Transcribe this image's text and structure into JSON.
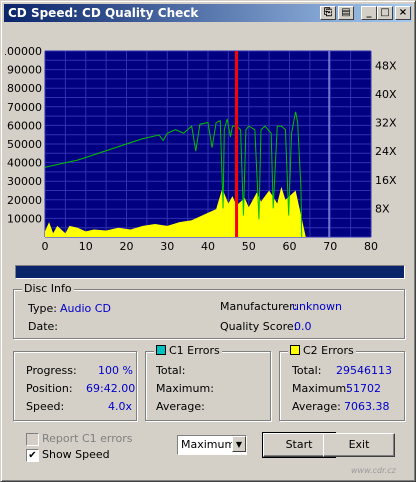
{
  "window": {
    "title": "CD Speed: CD Quality Check",
    "buttons": [
      "?",
      "?",
      "_",
      "□",
      "×"
    ]
  },
  "chart_data": {
    "type": "line",
    "y_left": {
      "range": [
        0,
        100000
      ],
      "ticks": [
        "10000",
        "20000",
        "30000",
        "40000",
        "50000",
        "60000",
        "70000",
        "80000",
        "90000",
        "100000"
      ]
    },
    "y_right": {
      "range": [
        0,
        52
      ],
      "ticks": [
        "8X",
        "16X",
        "24X",
        "32X",
        "40X",
        "48X"
      ]
    },
    "x": {
      "range": [
        0,
        80
      ],
      "ticks": [
        "0",
        "10",
        "20",
        "30",
        "40",
        "50",
        "60",
        "70",
        "80"
      ]
    },
    "colors": {
      "bg": "#000080",
      "grid": "#3030b0",
      "speed": "#00c000",
      "errors": "#ffff00",
      "position": "#ff0000",
      "end": "#c0c0ff"
    },
    "position_marker": 47,
    "end_marker": 69.7,
    "speed_series": [
      [
        0,
        19.5
      ],
      [
        4,
        20.5
      ],
      [
        8,
        21.5
      ],
      [
        12,
        23
      ],
      [
        16,
        24.5
      ],
      [
        20,
        26
      ],
      [
        24,
        27.5
      ],
      [
        28,
        28.5
      ],
      [
        29,
        27
      ],
      [
        30,
        29
      ],
      [
        32,
        30
      ],
      [
        34,
        29
      ],
      [
        36,
        31
      ],
      [
        37,
        24
      ],
      [
        38,
        31.5
      ],
      [
        40,
        32
      ],
      [
        41,
        25
      ],
      [
        42,
        32
      ],
      [
        43,
        32.5
      ],
      [
        43.7,
        8
      ],
      [
        44,
        30
      ],
      [
        44.7,
        33
      ],
      [
        45.5,
        28
      ],
      [
        46,
        31
      ],
      [
        47,
        31
      ],
      [
        48,
        30
      ],
      [
        48.7,
        6
      ],
      [
        49.3,
        30
      ],
      [
        50,
        31
      ],
      [
        51.5,
        30
      ],
      [
        52.5,
        5
      ],
      [
        53,
        30
      ],
      [
        54,
        31
      ],
      [
        55.5,
        29
      ],
      [
        56,
        8
      ],
      [
        57,
        31
      ],
      [
        58,
        31
      ],
      [
        59,
        30
      ],
      [
        59.8,
        6
      ],
      [
        60.5,
        29
      ],
      [
        61.5,
        35
      ],
      [
        62,
        32
      ],
      [
        62.8,
        14
      ],
      [
        63,
        0
      ]
    ],
    "error_series": [
      [
        0,
        3000
      ],
      [
        1,
        8000
      ],
      [
        2,
        2000
      ],
      [
        3,
        6000
      ],
      [
        5,
        2000
      ],
      [
        6,
        6000
      ],
      [
        8,
        5000
      ],
      [
        10,
        3000
      ],
      [
        12,
        4000
      ],
      [
        15,
        3500
      ],
      [
        18,
        5000
      ],
      [
        21,
        4000
      ],
      [
        24,
        6000
      ],
      [
        27,
        7000
      ],
      [
        30,
        6000
      ],
      [
        33,
        8000
      ],
      [
        36,
        9000
      ],
      [
        39,
        12000
      ],
      [
        42,
        15000
      ],
      [
        43.5,
        26000
      ],
      [
        45,
        18000
      ],
      [
        46,
        22000
      ],
      [
        47,
        17000
      ],
      [
        49,
        21000
      ],
      [
        50,
        16000
      ],
      [
        52,
        24000
      ],
      [
        53,
        19000
      ],
      [
        55,
        25000
      ],
      [
        57,
        18000
      ],
      [
        58,
        27000
      ],
      [
        59,
        20000
      ],
      [
        60,
        22000
      ],
      [
        61.5,
        25000
      ],
      [
        63,
        10000
      ],
      [
        64,
        0
      ]
    ]
  },
  "disc_info": {
    "title": "Disc Info",
    "type_label": "Type:",
    "type_value": "Audio CD",
    "date_label": "Date:",
    "manufacturer_label": "Manufacturer:",
    "manufacturer_value": "unknown",
    "quality_label": "Quality Score:",
    "quality_value": "0.0"
  },
  "status": {
    "progress_label": "Progress:",
    "progress_value": "100 %",
    "position_label": "Position:",
    "position_value": "69:42.00",
    "speed_label": "Speed:",
    "speed_value": "4.0x"
  },
  "c1": {
    "title": "C1 Errors",
    "color": "#00c0c0",
    "total_label": "Total:",
    "maximum_label": "Maximum:",
    "average_label": "Average:"
  },
  "c2": {
    "title": "C2 Errors",
    "color": "#ffff00",
    "total_label": "Total:",
    "total_value": "29546113",
    "maximum_label": "Maximum:",
    "maximum_value": "51702",
    "average_label": "Average:",
    "average_value": "7063.38"
  },
  "options": {
    "report_c1_label": "Report C1 errors",
    "report_c1_checked": false,
    "show_speed_label": "Show Speed",
    "show_speed_checked": true,
    "mode_select": "Maximum"
  },
  "buttons": {
    "start": "Start",
    "exit": "Exit"
  },
  "watermark": "www.cdr.cz",
  "progress_fraction": 1.0
}
